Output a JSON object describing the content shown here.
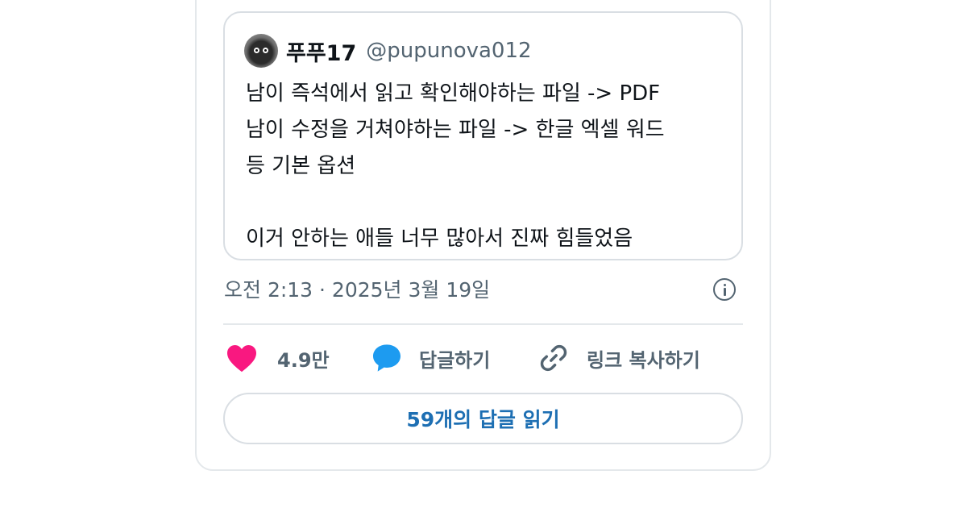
{
  "quoted_post": {
    "display_name": "푸푸17",
    "handle": "@pupunova012",
    "text": "남이 즉석에서 읽고 확인해야하는 파일 -> PDF\n남이 수정을 거쳐야하는 파일 -> 한글 엑셀 워드\n등 기본 옵션\n\n이거 안하는 애들 너무 많아서 진짜 힘들었음"
  },
  "meta": {
    "timestamp": "오전 2:13 · 2025년 3월 19일",
    "info_icon": "info-circle-icon"
  },
  "actions": {
    "like_count": "4.9만",
    "like_icon": "heart-icon",
    "like_color": "#f91880",
    "reply_label": "답글하기",
    "reply_icon": "speech-bubble-icon",
    "reply_color": "#1d9bf0",
    "copy_link_label": "링크 복사하기",
    "copy_link_icon": "link-icon"
  },
  "read_replies_button": "59개의 답글 읽기",
  "colors": {
    "accent": "#1d6fb3",
    "muted_text": "#536471",
    "border": "#e4e8eb"
  }
}
